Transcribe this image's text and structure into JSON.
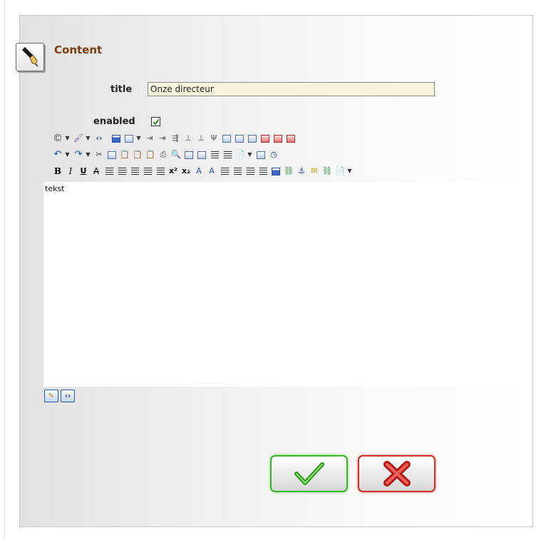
{
  "section": {
    "title": "Content",
    "icon": "pen-icon"
  },
  "form": {
    "title_label": "title",
    "title_value": "Onze directeur",
    "enabled_label": "enabled",
    "enabled_checked": true
  },
  "editor": {
    "content": "tekst",
    "toolbar_rows": [
      [
        "copyright-icon",
        "dropdown-arrow-icon",
        "brush-icon",
        "dropdown-arrow-icon",
        "code-tag-icon",
        "image-icon",
        "table-icon",
        "dropdown-arrow-icon",
        "insert-row-icon",
        "insert-row-after-icon",
        "insert-column-icon",
        "merge-cells-icon",
        "split-cells-icon",
        "split-cells-vertical-icon",
        "table-props-icon",
        "cell-props-icon",
        "row-props-icon",
        "delete-row-icon",
        "delete-column-icon",
        "table-delete-icon"
      ],
      [
        "undo-icon",
        "dropdown-arrow-icon",
        "redo-icon",
        "dropdown-arrow-icon",
        "cut-icon",
        "copy-icon",
        "paste-icon",
        "paste-text-icon",
        "paste-word-icon",
        "print-icon",
        "find-icon",
        "select-all-icon",
        "replace-icon",
        "line-spacing-icon",
        "list-icon",
        "template-icon",
        "dropdown-arrow-icon",
        "snippet-icon",
        "time-icon"
      ],
      [
        "bold-icon",
        "italic-icon",
        "underline-icon",
        "strikethrough-icon",
        "align-left-icon",
        "align-center-icon",
        "align-right-icon",
        "justify-icon",
        "justify-full-icon",
        "superscript-icon",
        "subscript-icon",
        "font-color-icon",
        "highlight-color-icon",
        "indent-icon",
        "outdent-icon",
        "ordered-list-icon",
        "unordered-list-icon",
        "image-manager-icon",
        "link-icon",
        "anchor-icon",
        "email-link-icon",
        "unlink-icon",
        "html-source-icon",
        "dropdown-arrow-icon"
      ]
    ],
    "modes": [
      "design-mode-icon",
      "html-mode-icon"
    ]
  },
  "actions": {
    "confirm_icon": "checkmark-icon",
    "cancel_icon": "cross-icon",
    "confirm_color": "#3bb42a",
    "cancel_color": "#cf2f26"
  },
  "colors": {
    "title": "#7a3c0e",
    "input_bg": "#f8f3dc"
  }
}
